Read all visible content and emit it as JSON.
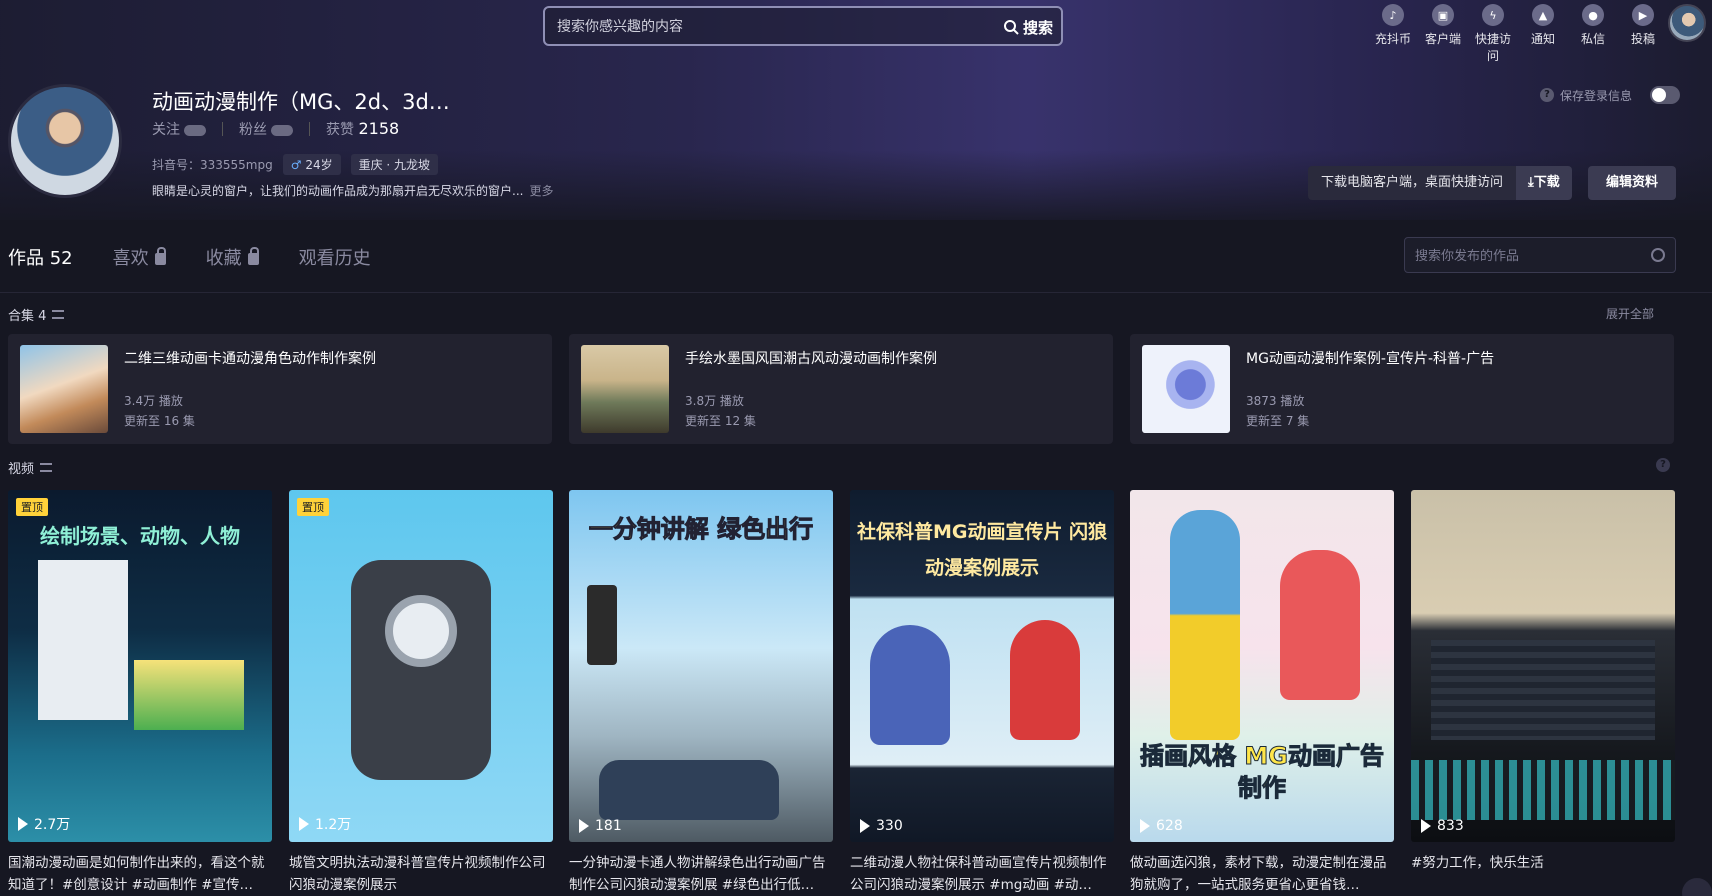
{
  "header": {
    "search_placeholder": "搜索你感兴趣的内容",
    "search_button": "搜索",
    "nav": [
      {
        "label": "充抖币",
        "icon": "coin-icon"
      },
      {
        "label": "客户端",
        "icon": "client-icon"
      },
      {
        "label": "快捷访问",
        "icon": "lightning-icon"
      },
      {
        "label": "通知",
        "icon": "bell-icon"
      },
      {
        "label": "私信",
        "icon": "message-icon"
      },
      {
        "label": "投稿",
        "icon": "upload-icon"
      }
    ]
  },
  "profile": {
    "name": "动画动漫制作（MG、2d、3d…",
    "follow_label": "关注",
    "fans_label": "粉丝",
    "likes_label": "获赞",
    "likes_value": "2158",
    "douyin_id": "抖音号：333555mpg",
    "age": "24岁",
    "gender_symbol": "♂",
    "location": "重庆 · 九龙坡",
    "bio": "眼睛是心灵的窗户，让我们的动画作品成为那扇开启无尽欢乐的窗户...",
    "bio_more": "更多",
    "save_login": "保存登录信息",
    "download_text": "下载电脑客户端，桌面快捷访问",
    "download_button": "⤓下载",
    "edit_button": "编辑资料"
  },
  "tabs": [
    {
      "label": "作品 52",
      "active": true,
      "locked": false
    },
    {
      "label": "喜欢",
      "active": false,
      "locked": true
    },
    {
      "label": "收藏",
      "active": false,
      "locked": true
    },
    {
      "label": "观看历史",
      "active": false,
      "locked": false
    }
  ],
  "work_search_placeholder": "搜索你发布的作品",
  "collections": {
    "label": "合集 4",
    "expand": "展开全部",
    "items": [
      {
        "title": "二维三维动画卡通动漫角色动作制作案例",
        "plays": "3.4万 播放",
        "updated": "更新至 16 集"
      },
      {
        "title": "手绘水墨国风国潮古风动漫动画制作案例",
        "plays": "3.8万 播放",
        "updated": "更新至 12 集"
      },
      {
        "title": "MG动画动漫制作案例-宣传片-科普-广告",
        "plays": "3873 播放",
        "updated": "更新至 7 集"
      }
    ]
  },
  "videos": {
    "label": "视频",
    "items": [
      {
        "pinned": "置顶",
        "overlay": "绘制场景、动物、人物",
        "plays": "2.7万",
        "caption": "国潮动漫动画是如何制作出来的，看这个就知道了！#创意设计 #动画制作 #宣传…"
      },
      {
        "pinned": "置顶",
        "overlay": "",
        "plays": "1.2万",
        "caption": "城管文明执法动漫科普宣传片视频制作公司闪狼动漫案例展示"
      },
      {
        "pinned": "",
        "overlay": "一分钟讲解 绿色出行",
        "plays": "181",
        "caption": "一分钟动漫卡通人物讲解绿色出行动画广告制作公司闪狼动漫案例展 #绿色出行低…"
      },
      {
        "pinned": "",
        "overlay": "社保科普MG动画宣传片 闪狼动漫案例展示",
        "plays": "330",
        "caption": "二维动漫人物社保科普动画宣传片视频制作公司闪狼动漫案例展示 #mg动画 #动…"
      },
      {
        "pinned": "",
        "overlay": "插画风格 MG动画广告制作",
        "plays": "628",
        "caption": "做动画选闪狼，素材下载，动漫定制在漫品狗就购了，一站式服务更省心更省钱…"
      },
      {
        "pinned": "",
        "overlay": "",
        "plays": "833",
        "caption": "#努力工作，快乐生活"
      }
    ]
  }
}
